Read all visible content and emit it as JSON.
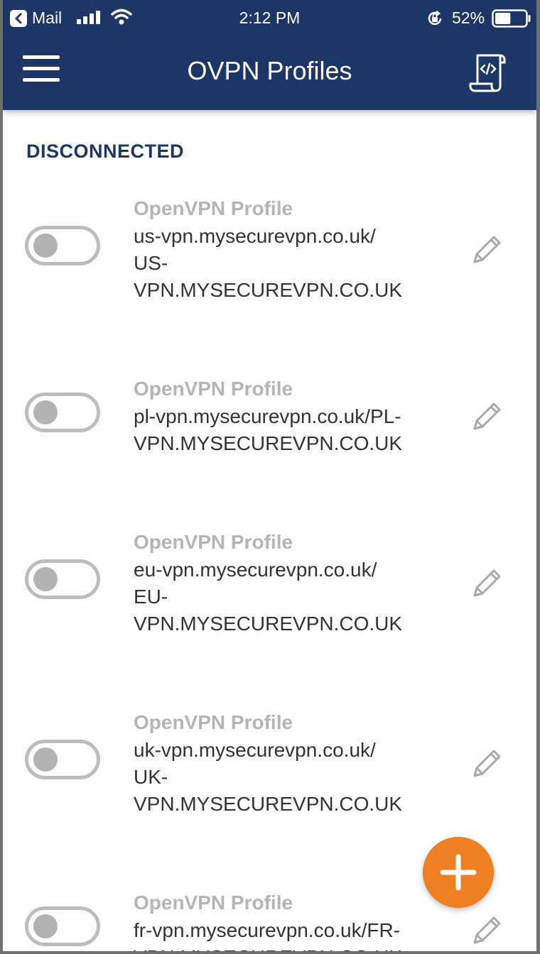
{
  "status_bar": {
    "back_app": "Mail",
    "time": "2:12 PM",
    "battery": "52%",
    "battery_level": 0.52
  },
  "header": {
    "title": "OVPN Profiles",
    "menu_icon": "hamburger-menu-icon",
    "import_icon": "code-file-icon"
  },
  "section": {
    "label": "DISCONNECTED"
  },
  "profiles": [
    {
      "name": "OpenVPN Profile",
      "host": "us-vpn.mysecurevpn.co.uk/\nUS-\nVPN.MYSECUREVPN.CO.UK",
      "connected": false
    },
    {
      "name": "OpenVPN Profile",
      "host": "pl-vpn.mysecurevpn.co.uk/PL-\nVPN.MYSECUREVPN.CO.UK",
      "connected": false
    },
    {
      "name": "OpenVPN Profile",
      "host": "eu-vpn.mysecurevpn.co.uk/\nEU-\nVPN.MYSECUREVPN.CO.UK",
      "connected": false
    },
    {
      "name": "OpenVPN Profile",
      "host": "uk-vpn.mysecurevpn.co.uk/\nUK-\nVPN.MYSECUREVPN.CO.UK",
      "connected": false
    },
    {
      "name": "OpenVPN Profile",
      "host": "fr-vpn.mysecurevpn.co.uk/FR-\nVPN.MYSECUREVPN.CO.UK",
      "connected": false
    }
  ],
  "colors": {
    "header_bg": "#1c3766",
    "accent": "#ee7f22",
    "section_label": "#1c3766"
  }
}
